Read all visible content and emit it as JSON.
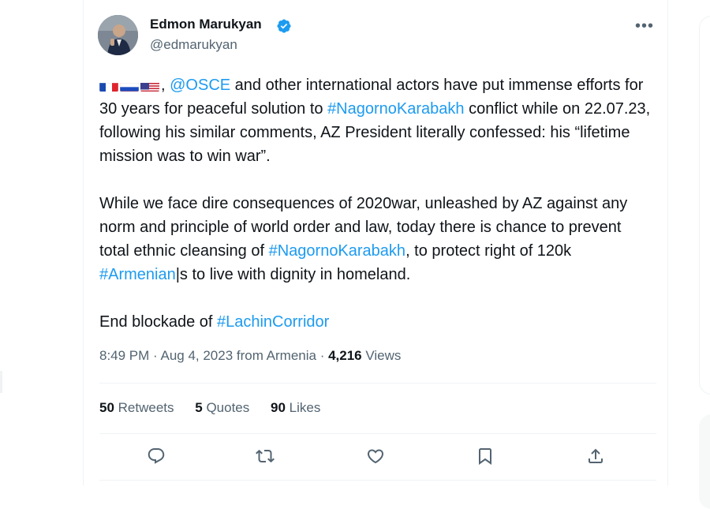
{
  "tweet": {
    "author_name": "Edmon Marukyan",
    "author_handle": "@edmarukyan",
    "para1": {
      "sep": ",",
      "mention": "@OSCE",
      "t1": " and other international actors have put immense efforts for 30 years for peaceful solution to ",
      "hashtag1": "#NagornoKarabakh",
      "t2": " conflict while on 22.07.23, following his similar comments, AZ President literally confessed: his “lifetime mission was to win war”."
    },
    "para2": {
      "t1": "While we face dire consequences of 2020war, unleashed by AZ against any norm and principle of world order and law, today there is chance to prevent total ethnic cleansing of ",
      "hashtag1": "#NagornoKarabakh",
      "t2": ", to protect right of 120k ",
      "hashtag2": "#Armenian",
      "t3": "|s to live with dignity in homeland."
    },
    "para3": {
      "t1": "End blockade of ",
      "hashtag1": "#LachinCorridor"
    },
    "meta": {
      "time": "8:49 PM · Aug 4, 2023 from Armenia · ",
      "views_count": "4,216",
      "views_label": " Views"
    },
    "stats": {
      "retweets_count": "50",
      "retweets_label": " Retweets",
      "quotes_count": "5",
      "quotes_label": " Quotes",
      "likes_count": "90",
      "likes_label": " Likes"
    }
  },
  "colors": {
    "link": "#1d9bf0",
    "text": "#0f1419",
    "secondary": "#536471",
    "border": "#eff3f4"
  },
  "icons": [
    "verified-badge-icon",
    "more-options-icon",
    "reply-icon",
    "retweet-icon",
    "like-icon",
    "bookmark-icon",
    "share-icon",
    "flag-france-icon",
    "flag-russia-icon",
    "flag-usa-icon"
  ]
}
